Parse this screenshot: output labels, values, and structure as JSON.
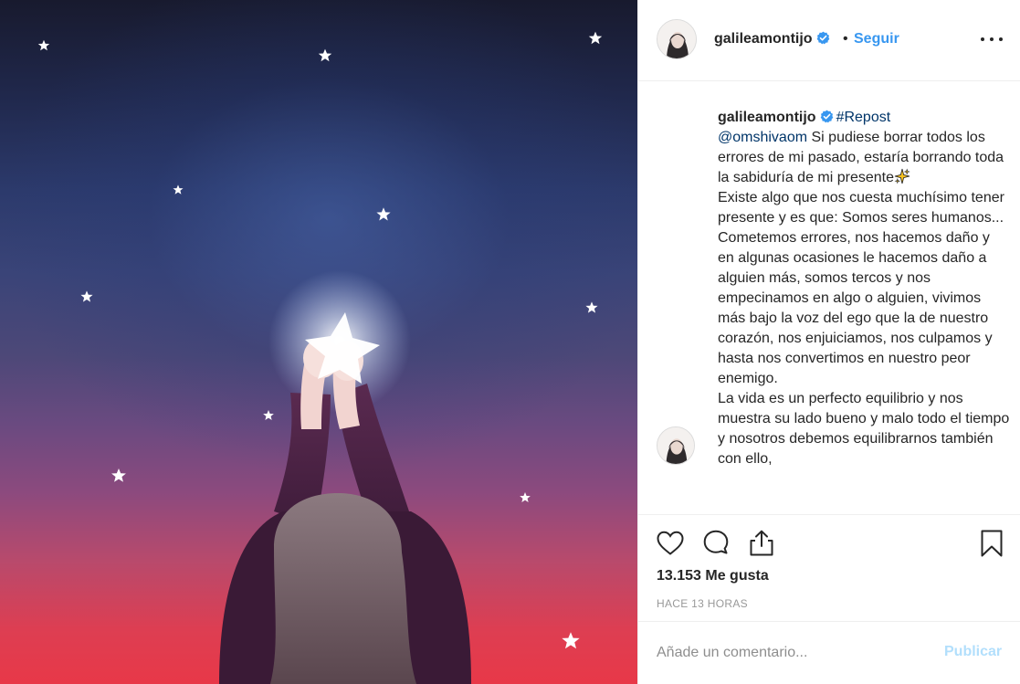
{
  "post": {
    "username": "galileamontijo",
    "verified": true,
    "separator": "•",
    "follow_label": "Seguir",
    "more_icon": "more-options-icon"
  },
  "caption": {
    "username": "galileamontijo",
    "hashtag": "#Repost",
    "mention": "@omshivaom",
    "text_first": "Si pudiese borrar todos los errores de mi pasado, estaría borrando toda la sabiduría de mi presente",
    "text_second": "Existe algo que nos cuesta muchísimo tener presente y es que: Somos seres humanos... Cometemos errores, nos hacemos daño y en algunas ocasiones le hacemos daño a alguien más, somos tercos y nos empecinamos en algo o alguien, vivimos más bajo la voz del ego que la de nuestro corazón, nos enjuiciamos, nos culpamos y hasta nos convertimos en nuestro peor enemigo.",
    "text_third": "La vida es un perfecto equilibrio y nos muestra su lado bueno y malo todo el tiempo y nosotros debemos equilibrarnos también con ello,",
    "emoji_icon": "sparkles-icon"
  },
  "actions": {
    "like_icon": "heart-icon",
    "comment_icon": "comment-icon",
    "share_icon": "share-icon",
    "save_icon": "bookmark-icon"
  },
  "likes_text": "13.153 Me gusta",
  "timestamp": "Hace 13 horas",
  "comment": {
    "placeholder": "Añade un comentario...",
    "publish_label": "Publicar"
  },
  "colors": {
    "link_blue": "#3897f0",
    "verified_blue": "#3897f0",
    "publish_disabled": "#b2dffc",
    "mention_dark_blue": "#003569"
  }
}
